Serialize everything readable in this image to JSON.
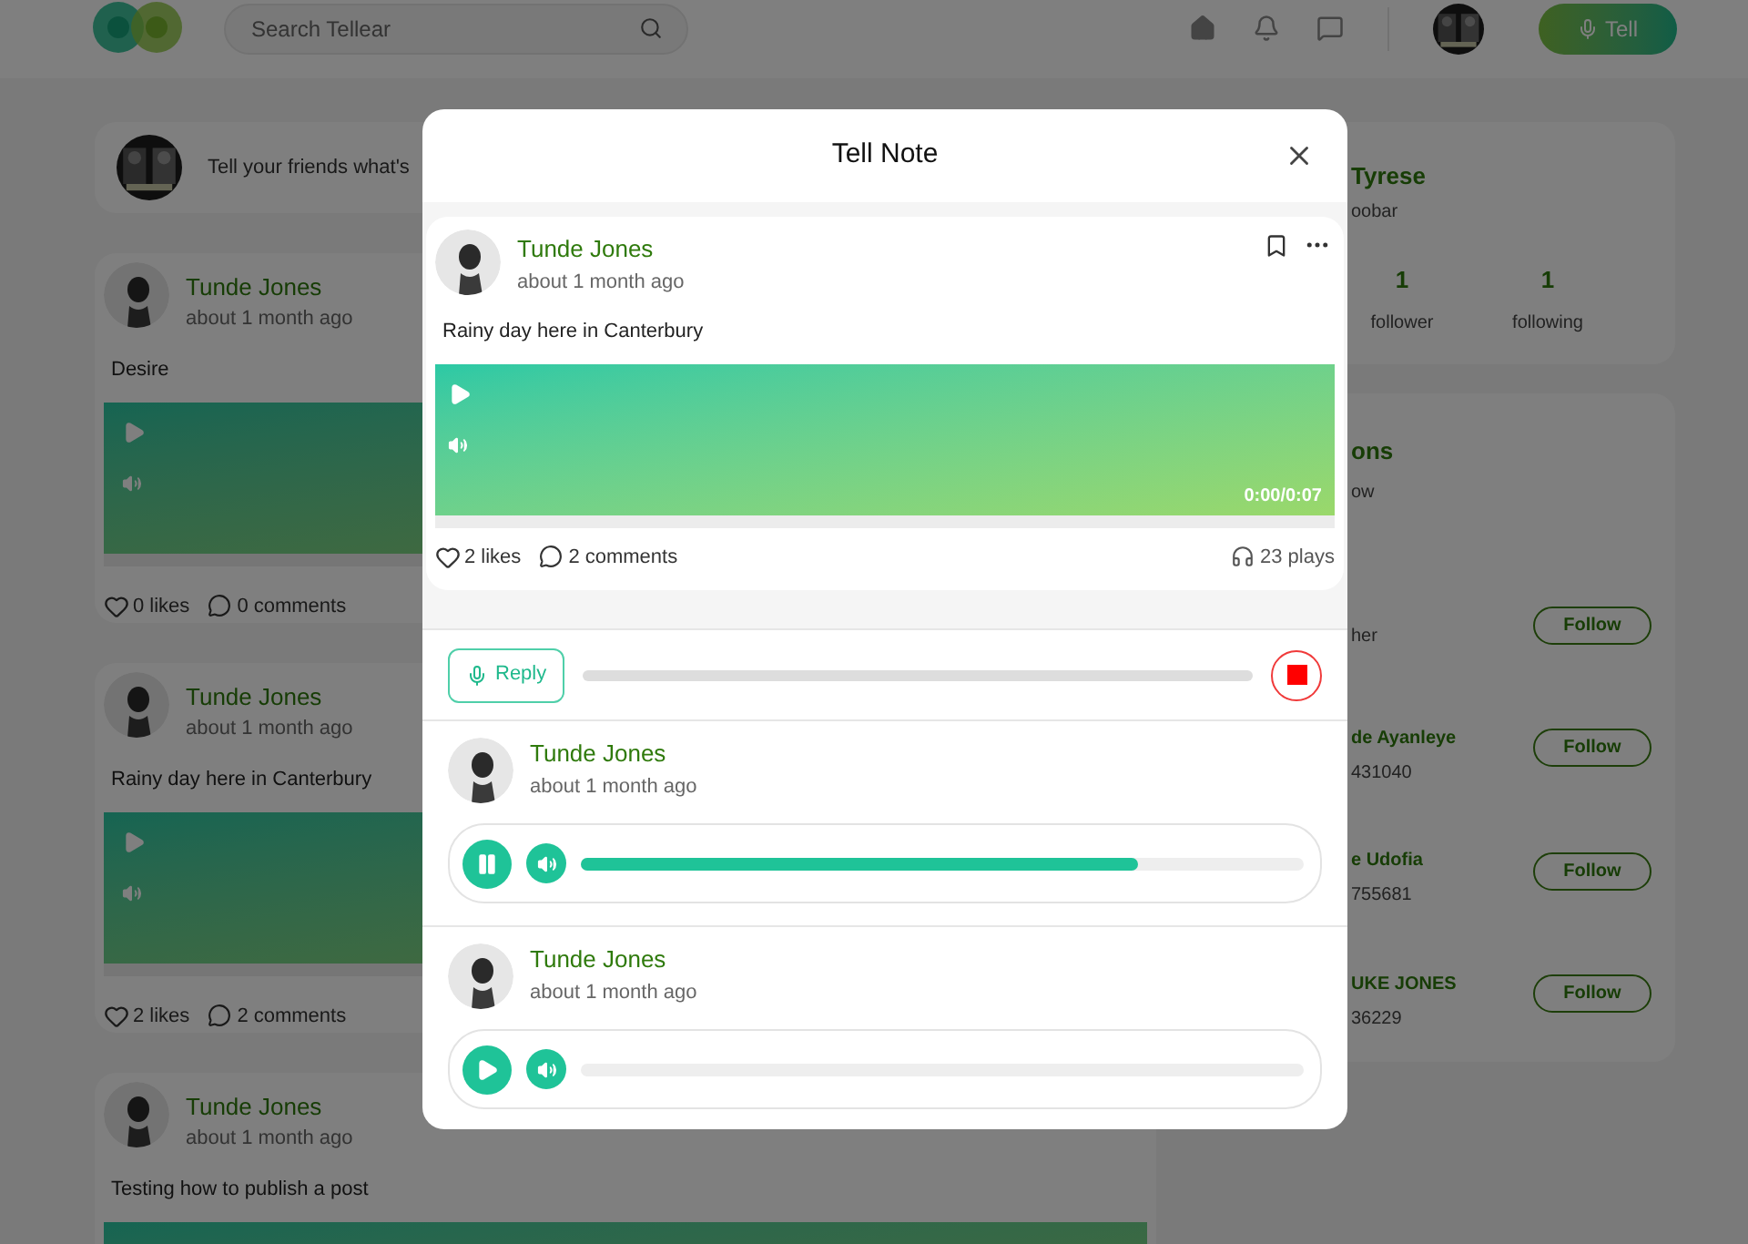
{
  "header": {
    "search": {
      "placeholder": "Search Tellear"
    },
    "tell_button": "Tell"
  },
  "composer": {
    "prompt": "Tell your friends what's"
  },
  "feed": [
    {
      "author": "Tunde Jones",
      "time": "about 1 month ago",
      "text": "Desire",
      "likes": "0 likes",
      "comments": "0 comments"
    },
    {
      "author": "Tunde Jones",
      "time": "about 1 month ago",
      "text": "Rainy day here in Canterbury",
      "likes": "2 likes",
      "comments": "2 comments"
    },
    {
      "author": "Tunde Jones",
      "time": "about 1 month ago",
      "text": "Testing how to publish a post"
    }
  ],
  "profile": {
    "name": "Tyrese",
    "handle": "oobar",
    "stats": [
      {
        "value": "1",
        "label": "follower"
      },
      {
        "value": "1",
        "label": "following"
      }
    ]
  },
  "suggestions": {
    "title": "ons",
    "subtitle": "ow",
    "people": [
      {
        "detail": "her",
        "button": "Follow"
      },
      {
        "name": "de Ayanleye",
        "detail": "431040",
        "button": "Follow"
      },
      {
        "name": "e Udofia",
        "detail": "755681",
        "button": "Follow"
      },
      {
        "name": "UKE JONES",
        "detail": "36229",
        "button": "Follow"
      }
    ]
  },
  "modal": {
    "title": "Tell Note",
    "post": {
      "author": "Tunde Jones",
      "time": "about 1 month ago",
      "text": "Rainy day here in Canterbury",
      "duration": "0:00/0:07",
      "likes": "2 likes",
      "comments": "2 comments",
      "plays": "23 plays"
    },
    "reply_button": "Reply",
    "replies": [
      {
        "author": "Tunde Jones",
        "time": "about 1 month ago",
        "playing": true,
        "level": 0.77
      },
      {
        "author": "Tunde Jones",
        "time": "about 1 month ago",
        "playing": false
      }
    ]
  }
}
